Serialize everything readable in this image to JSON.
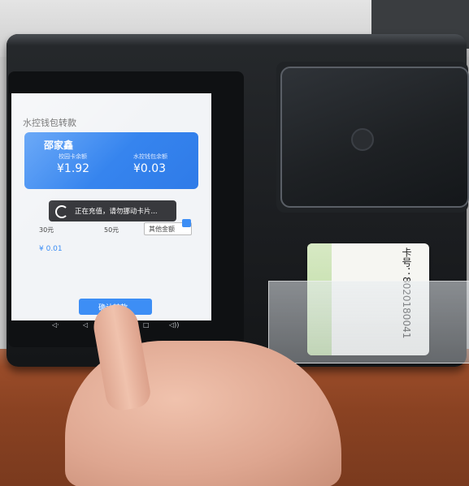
{
  "screen": {
    "title": "水控钱包转款",
    "card": {
      "name": "邵家鑫",
      "campus_balance_label": "校园卡余额",
      "campus_balance": "¥1.92",
      "water_balance_label": "水控钱包余额",
      "water_balance": "¥0.03"
    },
    "toast": "正在充值，请勿挪动卡片...",
    "amount_options": [
      "30元",
      "50元"
    ],
    "amount_other": "其他金额",
    "selected_amount": "¥ 0.01",
    "confirm_button": "确认转款"
  },
  "id_card": {
    "number_text": "卡号：8020180041"
  }
}
